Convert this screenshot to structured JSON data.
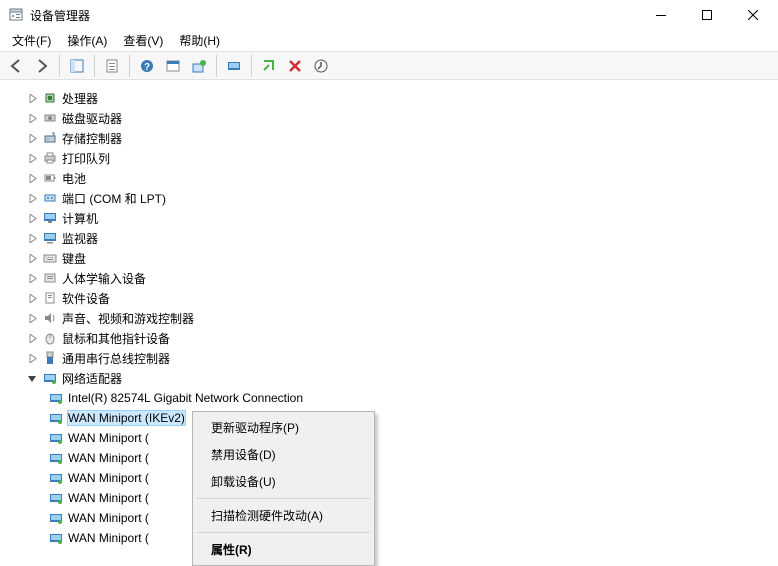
{
  "title": "设备管理器",
  "menu": {
    "file": "文件(F)",
    "action": "操作(A)",
    "view": "查看(V)",
    "help": "帮助(H)"
  },
  "icons": {
    "back": "back-icon",
    "forward": "forward-icon",
    "console": "console-icon",
    "prop": "properties-icon",
    "help": "help-icon",
    "action": "action-icon",
    "scan": "scan-icon",
    "monitor": "monitor-icon",
    "add": "add-icon",
    "remove": "remove-icon",
    "update": "update-icon"
  },
  "categories": [
    {
      "label": "处理器",
      "icon": "cpu"
    },
    {
      "label": "磁盘驱动器",
      "icon": "disk"
    },
    {
      "label": "存储控制器",
      "icon": "storage"
    },
    {
      "label": "打印队列",
      "icon": "printer"
    },
    {
      "label": "电池",
      "icon": "battery"
    },
    {
      "label": "端口 (COM 和 LPT)",
      "icon": "port"
    },
    {
      "label": "计算机",
      "icon": "computer"
    },
    {
      "label": "监视器",
      "icon": "display"
    },
    {
      "label": "键盘",
      "icon": "keyboard"
    },
    {
      "label": "人体学输入设备",
      "icon": "hid"
    },
    {
      "label": "软件设备",
      "icon": "software"
    },
    {
      "label": "声音、视频和游戏控制器",
      "icon": "sound"
    },
    {
      "label": "鼠标和其他指针设备",
      "icon": "mouse"
    },
    {
      "label": "通用串行总线控制器",
      "icon": "usb"
    }
  ],
  "network_label": "网络适配器",
  "network_children": [
    {
      "label": "Intel(R) 82574L Gigabit Network Connection"
    },
    {
      "label": "WAN Miniport (IKEv2)",
      "selected": true
    },
    {
      "label": "WAN Miniport (",
      "cut": true
    },
    {
      "label": "WAN Miniport (",
      "cut": true
    },
    {
      "label": "WAN Miniport (",
      "cut": true
    },
    {
      "label": "WAN Miniport (",
      "cut": true
    },
    {
      "label": "WAN Miniport (",
      "cut": true
    },
    {
      "label": "WAN Miniport (",
      "cut": true
    }
  ],
  "context_menu": [
    {
      "label": "更新驱动程序(P)"
    },
    {
      "label": "禁用设备(D)"
    },
    {
      "label": "卸载设备(U)"
    },
    {
      "sep": true
    },
    {
      "label": "扫描检测硬件改动(A)"
    },
    {
      "sep": true
    },
    {
      "label": "属性(R)",
      "bold": true
    }
  ]
}
